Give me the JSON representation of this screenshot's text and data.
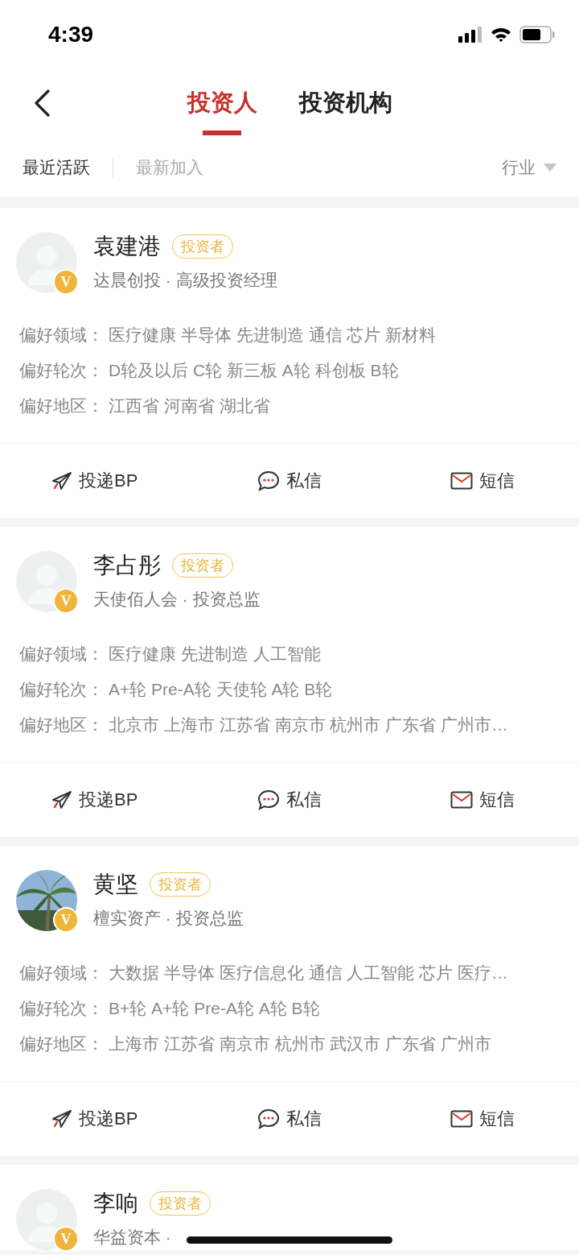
{
  "status_bar": {
    "time": "4:39"
  },
  "nav": {
    "tabs": [
      {
        "label": "投资人",
        "selected": true
      },
      {
        "label": "投资机构",
        "selected": false
      }
    ]
  },
  "filters": {
    "sort_options": [
      {
        "label": "最近活跃",
        "selected": true
      },
      {
        "label": "最新加入",
        "selected": false
      }
    ],
    "industry": "行业"
  },
  "investors": [
    {
      "name": "袁建港",
      "badge": "投资者",
      "verified_mark": "V",
      "avatar": {
        "kind": "default"
      },
      "subtitle": "达晨创投 · 高级投资经理",
      "preferences": [
        {
          "label": "偏好领域：",
          "value": "医疗健康 半导体 先进制造 通信 芯片 新材料"
        },
        {
          "label": "偏好轮次：",
          "value": "D轮及以后 C轮 新三板 A轮 科创板 B轮"
        },
        {
          "label": "偏好地区：",
          "value": "江西省 河南省 湖北省"
        }
      ],
      "actions": [
        {
          "kind": "send_bp",
          "label": "投递BP"
        },
        {
          "kind": "message",
          "label": "私信"
        },
        {
          "kind": "sms",
          "label": "短信"
        }
      ]
    },
    {
      "name": "李占彤",
      "badge": "投资者",
      "verified_mark": "V",
      "avatar": {
        "kind": "default"
      },
      "subtitle": "天使佰人会 · 投资总监",
      "preferences": [
        {
          "label": "偏好领域：",
          "value": "医疗健康 先进制造 人工智能"
        },
        {
          "label": "偏好轮次：",
          "value": "A+轮 Pre-A轮 天使轮 A轮 B轮"
        },
        {
          "label": "偏好地区：",
          "value": "北京市 上海市 江苏省 南京市 杭州市 广东省 广州市…"
        }
      ],
      "actions": [
        {
          "kind": "send_bp",
          "label": "投递BP"
        },
        {
          "kind": "message",
          "label": "私信"
        },
        {
          "kind": "sms",
          "label": "短信"
        }
      ]
    },
    {
      "name": "黄坚",
      "badge": "投资者",
      "verified_mark": "V",
      "avatar": {
        "kind": "picture"
      },
      "subtitle": "檀实资产 · 投资总监",
      "preferences": [
        {
          "label": "偏好领域：",
          "value": "大数据 半导体 医疗信息化 通信 人工智能 芯片 医疗…"
        },
        {
          "label": "偏好轮次：",
          "value": "B+轮 A+轮 Pre-A轮 A轮 B轮"
        },
        {
          "label": "偏好地区：",
          "value": "上海市 江苏省 南京市 杭州市 武汉市 广东省 广州市"
        }
      ],
      "actions": [
        {
          "kind": "send_bp",
          "label": "投递BP"
        },
        {
          "kind": "message",
          "label": "私信"
        },
        {
          "kind": "sms",
          "label": "短信"
        }
      ]
    },
    {
      "name": "李响",
      "badge": "投资者",
      "verified_mark": "V",
      "avatar": {
        "kind": "default"
      },
      "subtitle": "华益资本 ·"
    }
  ]
}
